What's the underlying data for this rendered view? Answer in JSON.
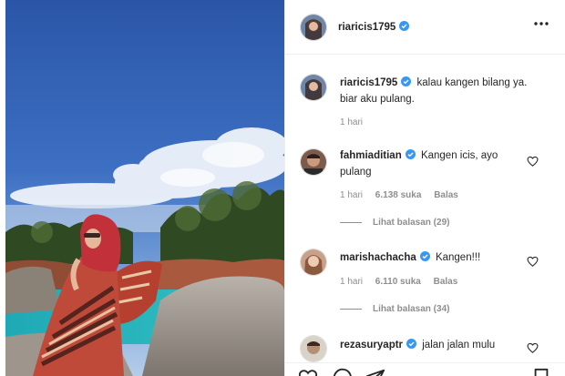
{
  "post": {
    "author": {
      "username": "riaricis1795",
      "verified": true
    },
    "more_icon": "more-horizontal-icon",
    "photo": {
      "subject": "photo-of-woman-in-hijab-on-rocky-coast"
    },
    "caption": {
      "username": "riaricis1795",
      "line1": "kalau kangen bilang ya.",
      "line2": "biar aku pulang.",
      "time": "1 hari"
    },
    "comments": [
      {
        "username": "fahmiaditian",
        "text_line1": "Kangen icis, ayo",
        "text_line2": "pulang",
        "time": "1 hari",
        "likes": "6.138 suka",
        "reply": "Balas",
        "view_replies": "Lihat balasan (29)"
      },
      {
        "username": "marishachacha",
        "text_line1": "Kangen!!!",
        "time": "1 hari",
        "likes": "6.110 suka",
        "reply": "Balas",
        "view_replies": "Lihat balasan (34)"
      },
      {
        "username": "rezasuryaptr",
        "text_line1": "jalan jalan mulu"
      }
    ],
    "colors": {
      "verified_blue": "#3897f0",
      "muted": "#8e8e8e",
      "text": "#262626",
      "divider": "#efefef"
    },
    "action_icons": [
      "heart-icon",
      "comment-icon",
      "share-icon",
      "bookmark-icon"
    ]
  }
}
